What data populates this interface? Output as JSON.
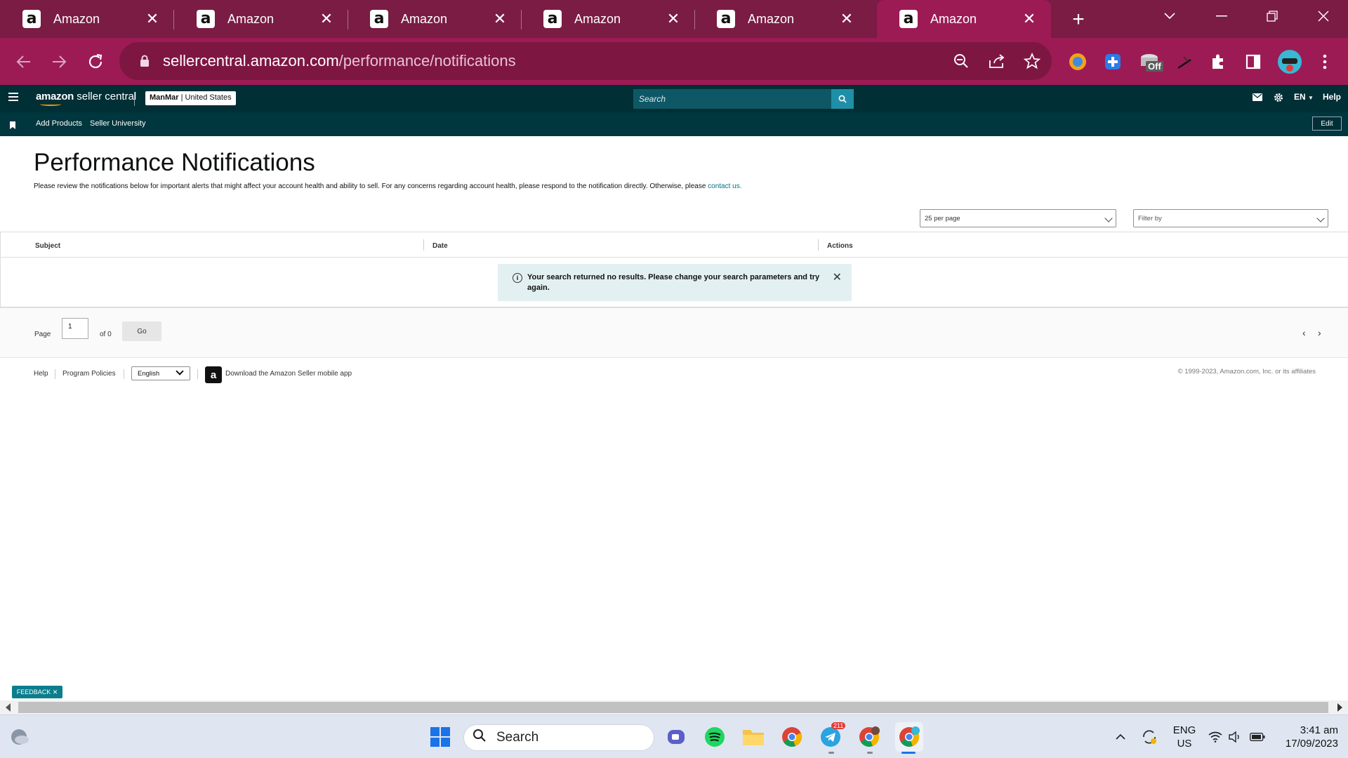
{
  "browser": {
    "tabs": [
      {
        "title": "Amazon"
      },
      {
        "title": "Amazon"
      },
      {
        "title": "Amazon"
      },
      {
        "title": "Amazon"
      },
      {
        "title": "Amazon"
      },
      {
        "title": "Amazon"
      }
    ],
    "active_tab": 5,
    "url_domain": "sellercentral.amazon.com",
    "url_path": "/performance/notifications",
    "favicon_letter": "a",
    "extension_badge": "Off"
  },
  "header": {
    "logo_brand": "amazon",
    "logo_product": " seller central",
    "store_name": "ManMar",
    "store_region": " | United States",
    "search_placeholder": "Search",
    "language": "EN",
    "help": "Help"
  },
  "nav": {
    "links": [
      "Add Products",
      "Seller University"
    ],
    "edit": "Edit"
  },
  "page": {
    "title": "Performance Notifications",
    "description": "Please review the notifications below for important alerts that might affect your account health and ability to sell. For any concerns regarding account health, please respond to the notification directly. Otherwise, please ",
    "contact_link": "contact us.",
    "per_page": "25 per page",
    "filter": "Filter by"
  },
  "table": {
    "columns": [
      "Subject",
      "Date",
      "Actions"
    ],
    "alert_message": "Your search returned no results. Please change your search parameters and try again."
  },
  "pager": {
    "page_label": "Page",
    "page_value": "1",
    "of_label": "of 0",
    "go": "Go"
  },
  "footer": {
    "help": "Help",
    "policies": "Program Policies",
    "language": "English",
    "app": "Download the Amazon Seller mobile app",
    "copyright": "© 1999-2023, Amazon.com, Inc. or its affiliates"
  },
  "feedback": "FEEDBACK",
  "taskbar": {
    "search": "Search",
    "telegram_badge": "211",
    "lang_line1": "ENG",
    "lang_line2": "US",
    "time": "3:41 am",
    "date": "17/09/2023"
  },
  "colors": {
    "tab_strip": "#7a1c44",
    "active_tab": "#9c1b55",
    "seller_header": "#002f36",
    "link": "#007185",
    "alert_bg": "#e3f0f2"
  }
}
